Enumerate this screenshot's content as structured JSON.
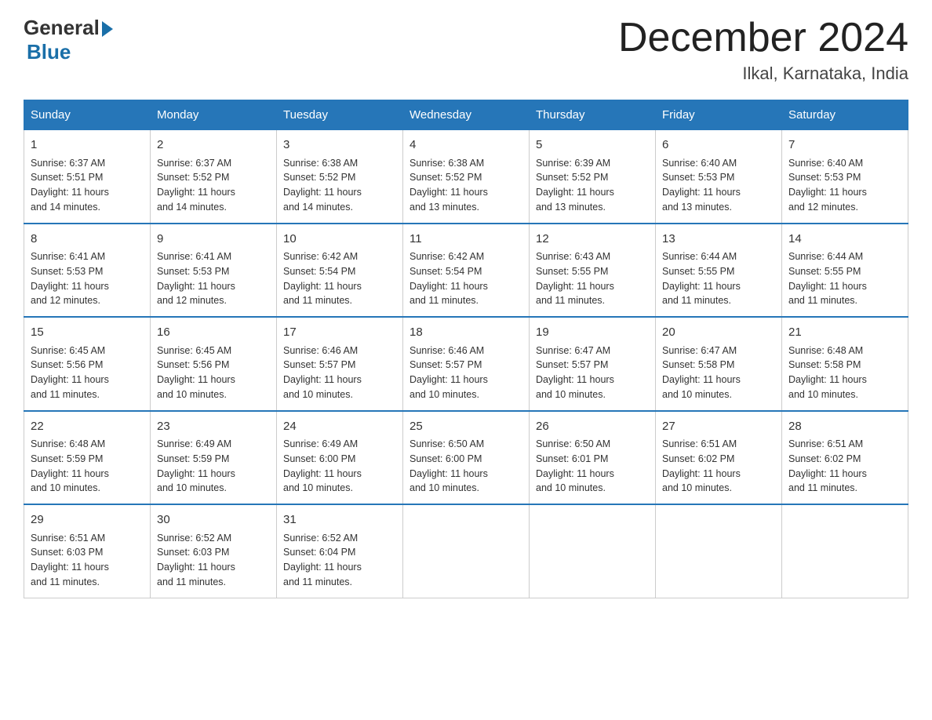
{
  "logo": {
    "general": "General",
    "triangle": "▶",
    "blue": "Blue"
  },
  "header": {
    "month": "December 2024",
    "location": "Ilkal, Karnataka, India"
  },
  "days_of_week": [
    "Sunday",
    "Monday",
    "Tuesday",
    "Wednesday",
    "Thursday",
    "Friday",
    "Saturday"
  ],
  "weeks": [
    [
      {
        "day": "1",
        "sunrise": "6:37 AM",
        "sunset": "5:51 PM",
        "daylight": "11 hours and 14 minutes."
      },
      {
        "day": "2",
        "sunrise": "6:37 AM",
        "sunset": "5:52 PM",
        "daylight": "11 hours and 14 minutes."
      },
      {
        "day": "3",
        "sunrise": "6:38 AM",
        "sunset": "5:52 PM",
        "daylight": "11 hours and 14 minutes."
      },
      {
        "day": "4",
        "sunrise": "6:38 AM",
        "sunset": "5:52 PM",
        "daylight": "11 hours and 13 minutes."
      },
      {
        "day": "5",
        "sunrise": "6:39 AM",
        "sunset": "5:52 PM",
        "daylight": "11 hours and 13 minutes."
      },
      {
        "day": "6",
        "sunrise": "6:40 AM",
        "sunset": "5:53 PM",
        "daylight": "11 hours and 13 minutes."
      },
      {
        "day": "7",
        "sunrise": "6:40 AM",
        "sunset": "5:53 PM",
        "daylight": "11 hours and 12 minutes."
      }
    ],
    [
      {
        "day": "8",
        "sunrise": "6:41 AM",
        "sunset": "5:53 PM",
        "daylight": "11 hours and 12 minutes."
      },
      {
        "day": "9",
        "sunrise": "6:41 AM",
        "sunset": "5:53 PM",
        "daylight": "11 hours and 12 minutes."
      },
      {
        "day": "10",
        "sunrise": "6:42 AM",
        "sunset": "5:54 PM",
        "daylight": "11 hours and 11 minutes."
      },
      {
        "day": "11",
        "sunrise": "6:42 AM",
        "sunset": "5:54 PM",
        "daylight": "11 hours and 11 minutes."
      },
      {
        "day": "12",
        "sunrise": "6:43 AM",
        "sunset": "5:55 PM",
        "daylight": "11 hours and 11 minutes."
      },
      {
        "day": "13",
        "sunrise": "6:44 AM",
        "sunset": "5:55 PM",
        "daylight": "11 hours and 11 minutes."
      },
      {
        "day": "14",
        "sunrise": "6:44 AM",
        "sunset": "5:55 PM",
        "daylight": "11 hours and 11 minutes."
      }
    ],
    [
      {
        "day": "15",
        "sunrise": "6:45 AM",
        "sunset": "5:56 PM",
        "daylight": "11 hours and 11 minutes."
      },
      {
        "day": "16",
        "sunrise": "6:45 AM",
        "sunset": "5:56 PM",
        "daylight": "11 hours and 10 minutes."
      },
      {
        "day": "17",
        "sunrise": "6:46 AM",
        "sunset": "5:57 PM",
        "daylight": "11 hours and 10 minutes."
      },
      {
        "day": "18",
        "sunrise": "6:46 AM",
        "sunset": "5:57 PM",
        "daylight": "11 hours and 10 minutes."
      },
      {
        "day": "19",
        "sunrise": "6:47 AM",
        "sunset": "5:57 PM",
        "daylight": "11 hours and 10 minutes."
      },
      {
        "day": "20",
        "sunrise": "6:47 AM",
        "sunset": "5:58 PM",
        "daylight": "11 hours and 10 minutes."
      },
      {
        "day": "21",
        "sunrise": "6:48 AM",
        "sunset": "5:58 PM",
        "daylight": "11 hours and 10 minutes."
      }
    ],
    [
      {
        "day": "22",
        "sunrise": "6:48 AM",
        "sunset": "5:59 PM",
        "daylight": "11 hours and 10 minutes."
      },
      {
        "day": "23",
        "sunrise": "6:49 AM",
        "sunset": "5:59 PM",
        "daylight": "11 hours and 10 minutes."
      },
      {
        "day": "24",
        "sunrise": "6:49 AM",
        "sunset": "6:00 PM",
        "daylight": "11 hours and 10 minutes."
      },
      {
        "day": "25",
        "sunrise": "6:50 AM",
        "sunset": "6:00 PM",
        "daylight": "11 hours and 10 minutes."
      },
      {
        "day": "26",
        "sunrise": "6:50 AM",
        "sunset": "6:01 PM",
        "daylight": "11 hours and 10 minutes."
      },
      {
        "day": "27",
        "sunrise": "6:51 AM",
        "sunset": "6:02 PM",
        "daylight": "11 hours and 10 minutes."
      },
      {
        "day": "28",
        "sunrise": "6:51 AM",
        "sunset": "6:02 PM",
        "daylight": "11 hours and 11 minutes."
      }
    ],
    [
      {
        "day": "29",
        "sunrise": "6:51 AM",
        "sunset": "6:03 PM",
        "daylight": "11 hours and 11 minutes."
      },
      {
        "day": "30",
        "sunrise": "6:52 AM",
        "sunset": "6:03 PM",
        "daylight": "11 hours and 11 minutes."
      },
      {
        "day": "31",
        "sunrise": "6:52 AM",
        "sunset": "6:04 PM",
        "daylight": "11 hours and 11 minutes."
      },
      null,
      null,
      null,
      null
    ]
  ],
  "labels": {
    "sunrise": "Sunrise:",
    "sunset": "Sunset:",
    "daylight": "Daylight:"
  }
}
